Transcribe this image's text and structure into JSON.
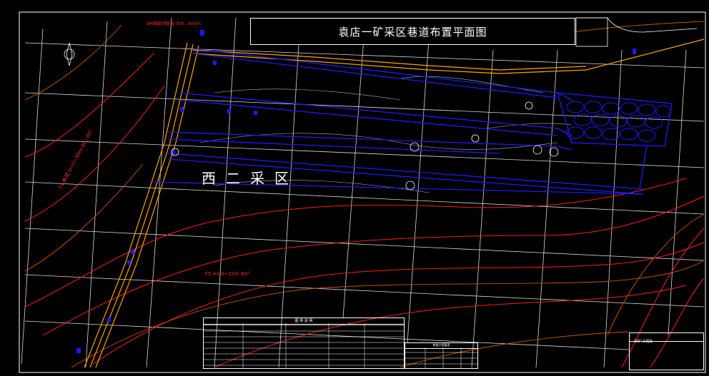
{
  "title": "袁店一矿采区巷道布置平面图",
  "area_label": "西二采区",
  "labels": {
    "top_left": "SM煤层顶底板-300..-600m",
    "left_diag": "F4 断层 H=0~90m 60~80°",
    "mid_red": "F5 H=0~10m 60°"
  },
  "stamp": {
    "title": "袁矿 工程处"
  },
  "legend": {
    "title": "图 例 说 明"
  },
  "notes": {
    "title": "巷道工程量表"
  },
  "colors": {
    "grid": "#ffffff",
    "roadway": "#1a1aff",
    "main_road": "#ffa500",
    "contour_red": "#ff1a1a",
    "contour_orange": "#cc5500"
  }
}
